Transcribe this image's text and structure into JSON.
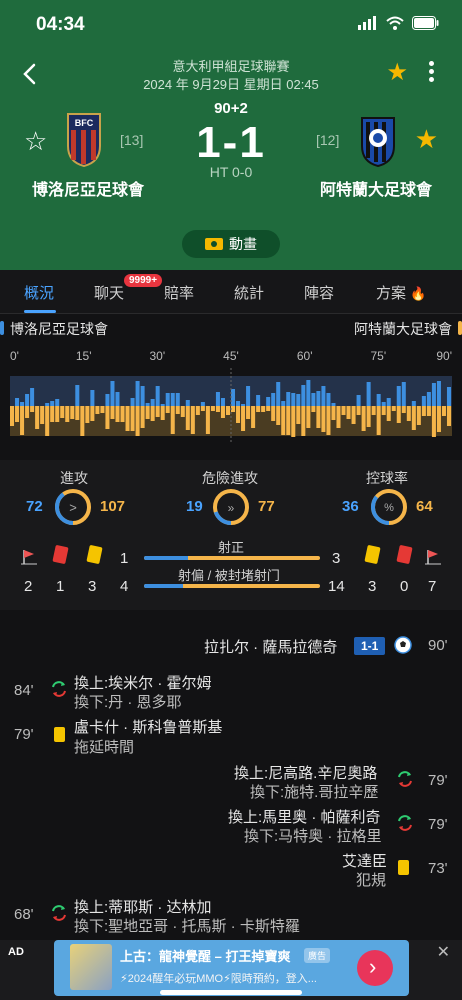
{
  "status": {
    "time": "04:34"
  },
  "match": {
    "league": "意大利甲組足球聯賽",
    "datetime": "2024 年 9月29日 星期日 02:45",
    "minute": "90+2",
    "score": "1-1",
    "ht": "HT 0-0",
    "home": {
      "name": "博洛尼亞足球會",
      "rank": "[13]"
    },
    "away": {
      "name": "阿特蘭大足球會",
      "rank": "[12]"
    },
    "animation_label": "動畫"
  },
  "tabs": [
    {
      "label": "概況"
    },
    {
      "label": "聊天"
    },
    {
      "label": "賠率"
    },
    {
      "label": "統計"
    },
    {
      "label": "陣容"
    },
    {
      "label": "方案"
    }
  ],
  "chat_badge": "9999+",
  "timeline": {
    "home": "博洛尼亞足球會",
    "away": "阿特蘭大足球會",
    "ticks": [
      "0'",
      "15'",
      "30'",
      "45'",
      "60'",
      "75'",
      "90'"
    ]
  },
  "stats": {
    "attack": {
      "title": "進攻",
      "home": "72",
      "away": "107",
      "home_pct": 40
    },
    "danger": {
      "title": "危險進攻",
      "home": "19",
      "away": "77",
      "home_pct": 20
    },
    "possession": {
      "title": "控球率",
      "home": "36",
      "away": "64",
      "home_pct": 36
    },
    "home_counts": {
      "corners": "2",
      "red": "1",
      "yellow": "3",
      "on_target": "1",
      "off_target": "4"
    },
    "away_counts": {
      "on_target": "3",
      "off_target": "14",
      "yellow": "3",
      "red": "0",
      "corners": "7"
    },
    "on_target_label": "射正",
    "off_target_label": "射偏 / 被封堵射门",
    "on_target_home_pct": 25,
    "off_target_home_pct": 22
  },
  "events": [
    {
      "side": "away",
      "text": "拉扎尔 · 薩馬拉德奇",
      "score": "1-1",
      "minute": "90'"
    },
    {
      "side": "home",
      "type": "sub",
      "in": "換上:埃米尔 · 霍尔姆",
      "out": "換下:丹 · 恩多耶",
      "minute": "84'"
    },
    {
      "side": "home",
      "type": "card",
      "in": "盧卡什 · 斯科鲁普斯基",
      "out": "拖延時間",
      "minute": "79'"
    },
    {
      "side": "away",
      "type": "sub",
      "in": "換上:尼高路.辛尼奧路",
      "out": "換下:施特.哥拉辛歷",
      "minute": "79'"
    },
    {
      "side": "away",
      "type": "sub",
      "in": "換上:馬里奥 · 帕薩利奇",
      "out": "換下:马特奥 · 拉格里",
      "minute": "79'"
    },
    {
      "side": "away",
      "type": "card",
      "in": "艾達臣",
      "out": "犯規",
      "minute": "73'"
    },
    {
      "side": "home",
      "type": "sub",
      "in": "換上:蒂耶斯 · 达林加",
      "out": "換下:聖地亞哥 · 托馬斯 · 卡斯特羅",
      "minute": "68'"
    }
  ],
  "ad": {
    "label": "AD",
    "close": "✕",
    "title": "上古：龍神覺醒 – 打王掉寶爽",
    "tag": "廣告",
    "desc": "⚡2024醒年必玩MMO⚡限時預約，登入..."
  },
  "colors": {
    "header": "#1f6b3d",
    "home": "#3d8fe0",
    "away": "#f5b54a",
    "accent": "#4aa3ff"
  }
}
